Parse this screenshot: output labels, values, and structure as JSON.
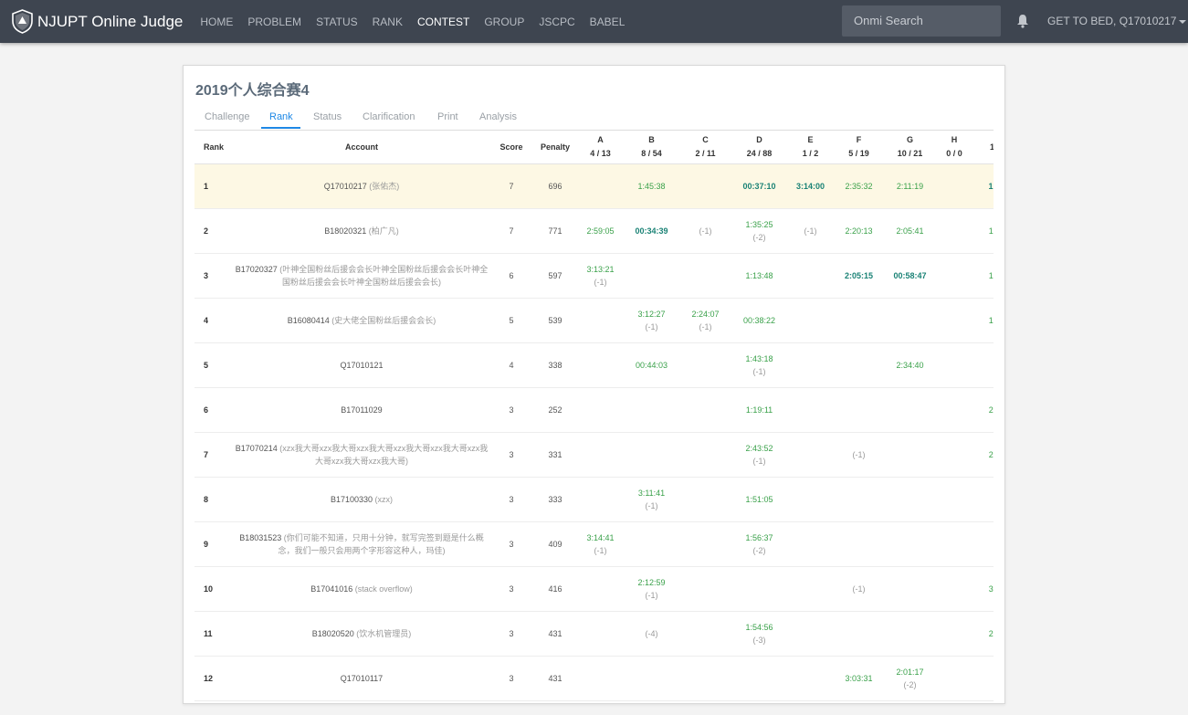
{
  "nav": {
    "brand": "NJUPT Online Judge",
    "items": [
      {
        "label": "HOME",
        "active": false
      },
      {
        "label": "PROBLEM",
        "active": false
      },
      {
        "label": "STATUS",
        "active": false
      },
      {
        "label": "RANK",
        "active": false
      },
      {
        "label": "CONTEST",
        "active": true
      },
      {
        "label": "GROUP",
        "active": false
      },
      {
        "label": "JSCPC",
        "active": false
      },
      {
        "label": "BABEL",
        "active": false
      }
    ],
    "search_placeholder": "Onmi Search",
    "user": "GET TO BED, Q17010217",
    "icons": {
      "logo": "shield-logo",
      "notify": "bell-icon",
      "dropdown": "caret-down-icon"
    }
  },
  "contest": {
    "title": "2019个人综合赛4",
    "tabs": [
      {
        "label": "Challenge",
        "active": false
      },
      {
        "label": "Rank",
        "active": true
      },
      {
        "label": "Status",
        "active": false
      },
      {
        "label": "Clarification",
        "active": false
      },
      {
        "label": "Print",
        "active": false
      },
      {
        "label": "Analysis",
        "active": false
      }
    ]
  },
  "table": {
    "headers": {
      "rank": "Rank",
      "account": "Account",
      "score": "Score",
      "penalty": "Penalty"
    },
    "problems": [
      {
        "id": "A",
        "stat": "4 / 13"
      },
      {
        "id": "B",
        "stat": "8 / 54"
      },
      {
        "id": "C",
        "stat": "2 / 11"
      },
      {
        "id": "D",
        "stat": "24 / 88"
      },
      {
        "id": "E",
        "stat": "1 / 2"
      },
      {
        "id": "F",
        "stat": "5 / 19"
      },
      {
        "id": "G",
        "stat": "10 / 21"
      },
      {
        "id": "H",
        "stat": "0 / 0"
      },
      {
        "id": "",
        "stat": "1"
      }
    ],
    "rows": [
      {
        "rank": "1",
        "account": "Q17010217",
        "nick": " (张佑杰)",
        "score": "7",
        "penalty": "696",
        "highlight": true,
        "cells": [
          null,
          {
            "t": "1:45:38",
            "s": "ac"
          },
          null,
          {
            "t": "00:37:10",
            "s": "fb"
          },
          {
            "t": "3:14:00",
            "s": "fb"
          },
          {
            "t": "2:35:32",
            "s": "ac"
          },
          {
            "t": "2:11:19",
            "s": "ac"
          },
          null,
          {
            "t": "1:",
            "s": "fb"
          }
        ]
      },
      {
        "rank": "2",
        "account": "B18020321",
        "nick": " (柏广凡)",
        "score": "7",
        "penalty": "771",
        "cells": [
          {
            "t": "2:59:05",
            "s": "ac"
          },
          {
            "t": "00:34:39",
            "s": "fb"
          },
          {
            "t": "(-1)",
            "s": "wa"
          },
          {
            "t": "1:35:25",
            "s": "ac",
            "tries": "(-2)"
          },
          {
            "t": "(-1)",
            "s": "wa"
          },
          {
            "t": "2:20:13",
            "s": "ac"
          },
          {
            "t": "2:05:41",
            "s": "ac"
          },
          null,
          {
            "t": "1:",
            "s": "ac"
          }
        ]
      },
      {
        "rank": "3",
        "account": "B17020327",
        "nick": " (叶神全国粉丝后援会会长叶神全国粉丝后援会会长叶神全国粉丝后援会会长叶神全国粉丝后援会会长)",
        "score": "6",
        "penalty": "597",
        "cells": [
          {
            "t": "3:13:21",
            "s": "ac",
            "tries": "(-1)"
          },
          null,
          null,
          {
            "t": "1:13:48",
            "s": "ac"
          },
          null,
          {
            "t": "2:05:15",
            "s": "fb"
          },
          {
            "t": "00:58:47",
            "s": "fb"
          },
          null,
          {
            "t": "1:",
            "s": "ac"
          }
        ]
      },
      {
        "rank": "4",
        "account": "B16080414",
        "nick": " (史大佬全国粉丝后援会会长)",
        "score": "5",
        "penalty": "539",
        "cells": [
          null,
          {
            "t": "3:12:27",
            "s": "ac",
            "tries": "(-1)"
          },
          {
            "t": "2:24:07",
            "s": "ac",
            "tries": "(-1)"
          },
          {
            "t": "00:38:22",
            "s": "ac"
          },
          null,
          null,
          null,
          null,
          {
            "t": "1:",
            "s": "ac"
          }
        ]
      },
      {
        "rank": "5",
        "account": "Q17010121",
        "nick": "",
        "score": "4",
        "penalty": "338",
        "cells": [
          null,
          {
            "t": "00:44:03",
            "s": "ac"
          },
          null,
          {
            "t": "1:43:18",
            "s": "ac",
            "tries": "(-1)"
          },
          null,
          null,
          {
            "t": "2:34:40",
            "s": "ac"
          },
          null,
          null
        ]
      },
      {
        "rank": "6",
        "account": "B17011029",
        "nick": "",
        "score": "3",
        "penalty": "252",
        "cells": [
          null,
          null,
          null,
          {
            "t": "1:19:11",
            "s": "ac"
          },
          null,
          null,
          null,
          null,
          {
            "t": "2:",
            "s": "ac"
          }
        ]
      },
      {
        "rank": "7",
        "account": "B17070214",
        "nick": " (xzx我大哥xzx我大哥xzx我大哥xzx我大哥xzx我大哥xzx我大哥xzx我大哥xzx我大哥)",
        "score": "3",
        "penalty": "331",
        "cells": [
          null,
          null,
          null,
          {
            "t": "2:43:52",
            "s": "ac",
            "tries": "(-1)"
          },
          null,
          {
            "t": "(-1)",
            "s": "wa"
          },
          null,
          null,
          {
            "t": "2:",
            "s": "ac"
          }
        ]
      },
      {
        "rank": "8",
        "account": "B17100330",
        "nick": " (xzx)",
        "score": "3",
        "penalty": "333",
        "cells": [
          null,
          {
            "t": "3:11:41",
            "s": "ac",
            "tries": "(-1)"
          },
          null,
          {
            "t": "1:51:05",
            "s": "ac"
          },
          null,
          null,
          null,
          null,
          null
        ]
      },
      {
        "rank": "9",
        "account": "B18031523",
        "nick": " (你们可能不知道，只用十分钟，就写完签到题是什么概念，我们一般只会用两个字形容这种人，玛佳)",
        "score": "3",
        "penalty": "409",
        "cells": [
          {
            "t": "3:14:41",
            "s": "ac",
            "tries": "(-1)"
          },
          null,
          null,
          {
            "t": "1:56:37",
            "s": "ac",
            "tries": "(-2)"
          },
          null,
          null,
          null,
          null,
          null
        ]
      },
      {
        "rank": "10",
        "account": "B17041016",
        "nick": " (stack overflow)",
        "score": "3",
        "penalty": "416",
        "cells": [
          null,
          {
            "t": "2:12:59",
            "s": "ac",
            "tries": "(-1)"
          },
          null,
          null,
          null,
          {
            "t": "(-1)",
            "s": "wa"
          },
          null,
          null,
          {
            "t": "3:",
            "s": "ac"
          }
        ]
      },
      {
        "rank": "11",
        "account": "B18020520",
        "nick": " (饮水机管理员)",
        "score": "3",
        "penalty": "431",
        "cells": [
          null,
          {
            "t": "(-4)",
            "s": "wa"
          },
          null,
          {
            "t": "1:54:56",
            "s": "ac",
            "tries": "(-3)"
          },
          null,
          null,
          null,
          null,
          {
            "t": "2:",
            "s": "ac"
          }
        ]
      },
      {
        "rank": "12",
        "account": "Q17010117",
        "nick": "",
        "score": "3",
        "penalty": "431",
        "cells": [
          null,
          null,
          null,
          null,
          null,
          {
            "t": "3:03:31",
            "s": "ac"
          },
          {
            "t": "2:01:17",
            "s": "ac",
            "tries": "(-2)"
          },
          null,
          null
        ]
      }
    ]
  },
  "colors": {
    "navbar": "#3e4550",
    "accent": "#1e88e5",
    "accepted": "#3aa14a",
    "first_blood": "#1a8275",
    "highlight": "#fdf8e4"
  }
}
